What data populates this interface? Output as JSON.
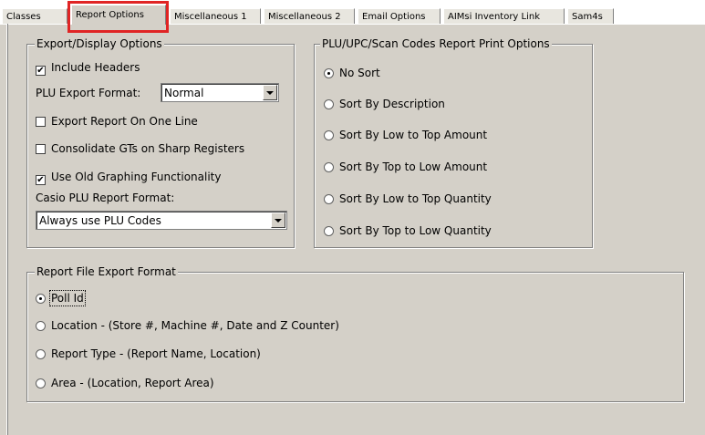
{
  "tabs": [
    {
      "label": "Classes"
    },
    {
      "label": "Report Options"
    },
    {
      "label": "Miscellaneous 1"
    },
    {
      "label": "Miscellaneous 2"
    },
    {
      "label": "Email Options"
    },
    {
      "label": "AIMsi Inventory Link"
    },
    {
      "label": "Sam4s"
    }
  ],
  "export_display": {
    "legend": "Export/Display Options",
    "include_headers": {
      "label": "Include Headers",
      "checked": true
    },
    "plu_export_format": {
      "label": "PLU Export Format:",
      "value": "Normal"
    },
    "export_one_line": {
      "label": "Export Report On One Line",
      "checked": false
    },
    "consolidate_gts": {
      "label": "Consolidate GTs on Sharp Registers",
      "checked": false
    },
    "old_graphing": {
      "label": "Use Old Graphing Functionality",
      "checked": true
    },
    "casio_format": {
      "label": "Casio PLU Report Format:",
      "value": "Always use PLU Codes"
    }
  },
  "plu_print_options": {
    "legend": "PLU/UPC/Scan Codes Report Print Options",
    "options": [
      {
        "label": "No Sort",
        "selected": true
      },
      {
        "label": "Sort By Description",
        "selected": false
      },
      {
        "label": "Sort By Low to Top Amount",
        "selected": false
      },
      {
        "label": "Sort By Top to Low Amount",
        "selected": false
      },
      {
        "label": "Sort By Low to Top Quantity",
        "selected": false
      },
      {
        "label": "Sort By Top to Low Quantity",
        "selected": false
      }
    ]
  },
  "file_export_format": {
    "legend": "Report File Export Format",
    "options": [
      {
        "label": "Poll Id",
        "selected": true
      },
      {
        "label": "Location - (Store #, Machine #, Date and Z Counter)",
        "selected": false
      },
      {
        "label": "Report Type - (Report Name, Location)",
        "selected": false
      },
      {
        "label": "Area - (Location, Report Area)",
        "selected": false
      }
    ]
  }
}
